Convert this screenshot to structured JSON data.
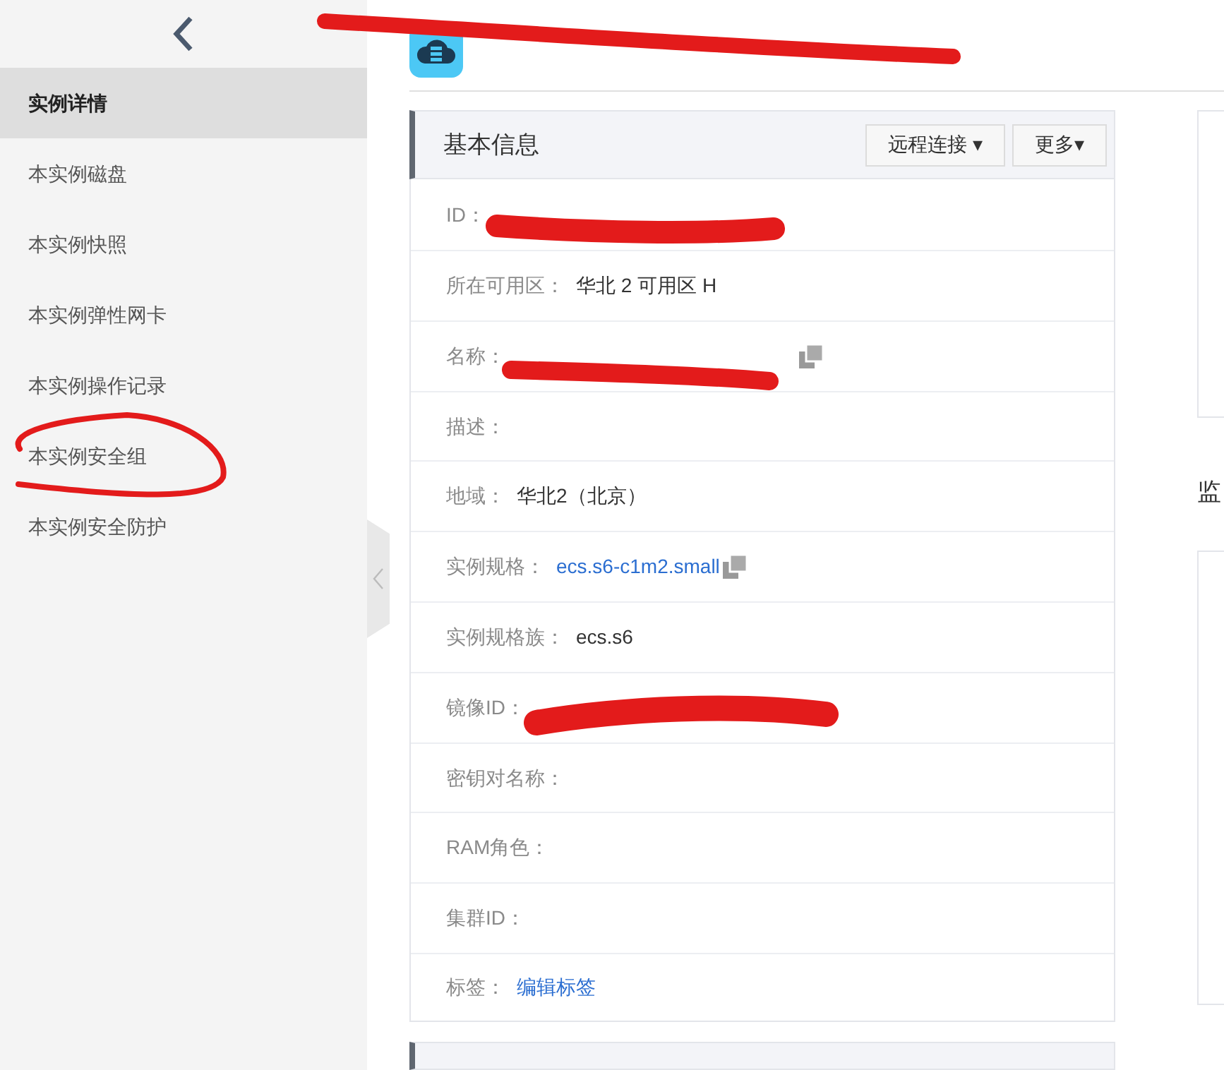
{
  "sidebar": {
    "items": [
      {
        "label": "实例详情",
        "selected": true
      },
      {
        "label": "本实例磁盘",
        "selected": false
      },
      {
        "label": "本实例快照",
        "selected": false
      },
      {
        "label": "本实例弹性网卡",
        "selected": false
      },
      {
        "label": "本实例操作记录",
        "selected": false
      },
      {
        "label": "本实例安全组",
        "selected": false
      },
      {
        "label": "本实例安全防护",
        "selected": false
      }
    ]
  },
  "panel": {
    "title": "基本信息",
    "buttons": [
      {
        "label": "远程连接 ▾"
      },
      {
        "label": "更多▾"
      }
    ],
    "rows": [
      {
        "label": "ID：",
        "copy": false
      },
      {
        "label": "所在可用区：",
        "value": "华北 2 可用区 H",
        "kind": "text",
        "copy": false
      },
      {
        "label": "名称：",
        "copy": true
      },
      {
        "label": "描述：",
        "copy": false
      },
      {
        "label": "地域：",
        "value": "华北2（北京）",
        "kind": "text",
        "copy": false
      },
      {
        "label": "实例规格：",
        "value": "ecs.s6-c1m2.small",
        "kind": "link",
        "copy": true
      },
      {
        "label": "实例规格族：",
        "value": "ecs.s6",
        "kind": "text",
        "copy": false
      },
      {
        "label": "镜像ID：",
        "copy": false
      },
      {
        "label": "密钥对名称：",
        "copy": false
      },
      {
        "label": "RAM角色：",
        "copy": false
      },
      {
        "label": "集群ID：",
        "copy": false
      },
      {
        "label": "标签：",
        "value": "编辑标签",
        "kind": "link",
        "copy": false
      }
    ]
  },
  "right": {
    "heading": "监"
  }
}
